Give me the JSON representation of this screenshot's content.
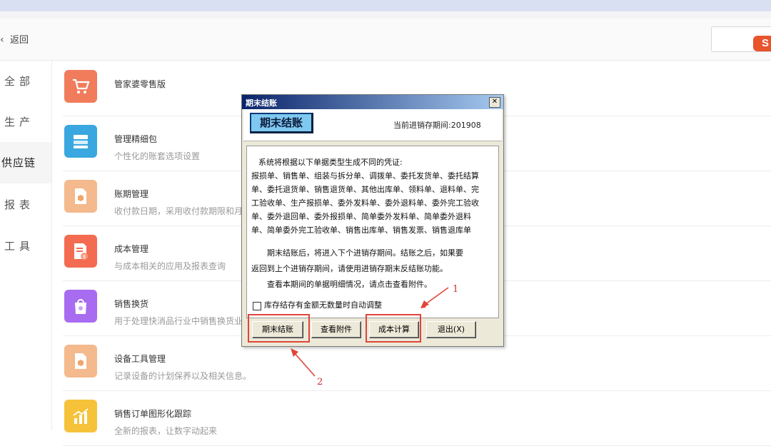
{
  "header": {
    "back_label": "返回",
    "search_placeholder": "",
    "ime_logo": "S"
  },
  "sidebar": {
    "items": [
      {
        "label": "全部"
      },
      {
        "label": "生产"
      },
      {
        "label": "供应链",
        "active": true
      },
      {
        "label": "报表"
      },
      {
        "label": "工具"
      }
    ]
  },
  "apps": [
    {
      "title": "管家婆零售版",
      "desc": "",
      "icon": "shopping-cart-icon",
      "color": "#f07c5c"
    },
    {
      "title": "管理精细包",
      "desc": "个性化的账套选项设置",
      "icon": "layers-icon",
      "color": "#3aa7e0"
    },
    {
      "title": "账期管理",
      "desc": "收付款日期，采用收付款期限和月",
      "icon": "document-box-icon",
      "color": "#f4b98c"
    },
    {
      "title": "成本管理",
      "desc": "与成本相关的应用及报表查询",
      "icon": "cost-document-icon",
      "color": "#f36b50"
    },
    {
      "title": "销售换货",
      "desc": "用于处理快消品行业中销售换货业务",
      "icon": "shopping-bag-icon",
      "color": "#a86cf0"
    },
    {
      "title": "设备工具管理",
      "desc": "记录设备的计划保养以及相关信息。",
      "icon": "document-box-icon",
      "color": "#f4b98c"
    },
    {
      "title": "销售订单图形化跟踪",
      "desc": "全新的报表，让数字动起来",
      "icon": "chart-icon",
      "color": "#f5c23a"
    }
  ],
  "dialog": {
    "title": "期末结账",
    "banner_label": "期末结账",
    "period_label": "当前进销存期间:201908",
    "lines": [
      "系统将根据以下单据类型生成不同的凭证:",
      "报损单、销售单、组装与拆分单、调拨单、委托发货单、委托结算",
      "单、委托退货单、销售退货单、其他出库单、领料单、退料单、完",
      "工验收单、生产报损单、委外发料单、委外退料单、委外完工验收",
      "单、委外退回单、委外报损单、简单委外发料单、简单委外退料",
      "单、简单委外完工验收单、销售出库单、销售发票、销售退库单"
    ],
    "para2_line1": "期末结账后，将进入下个进销存期间。结账之后，如果要",
    "para2_line2": "返回到上个进销存期间，请使用进销存期末反结账功能。",
    "para3": "查看本期间的单据明细情况，请点击查看附件。",
    "checkbox_label": "库存结存有金额无数量时自动调整",
    "checkbox_checked": false,
    "buttons": {
      "close_period": "期末结账",
      "view_attachment": "查看附件",
      "cost_calc": "成本计算",
      "exit": "退出(X)"
    },
    "close_glyph": "✕"
  },
  "annotations": {
    "one": "1",
    "two": "2"
  },
  "colors": {
    "annotation": "#e0453a",
    "titlebar_start": "#0a246a",
    "titlebar_end": "#a6caf0"
  }
}
